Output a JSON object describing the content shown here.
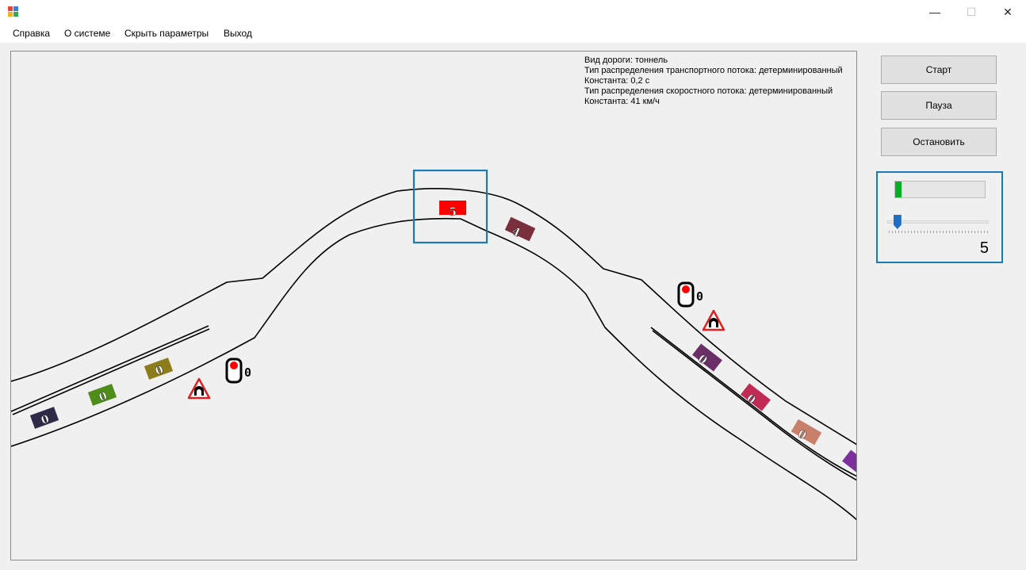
{
  "window": {
    "minimize_glyph": "—",
    "maximize_glyph": "☐",
    "close_glyph": "✕"
  },
  "menu": [
    "Справка",
    "О системе",
    "Скрыть параметры",
    "Выход"
  ],
  "info": {
    "lines": [
      "Вид дороги: тоннель",
      "Тип распределения транспортного потока: детерминированный",
      "Константа: 0,2 с",
      "Тип распределения скоростного потока: детерминированный",
      "Константа: 41 км/ч"
    ]
  },
  "buttons": {
    "start": "Старт",
    "pause": "Пауза",
    "stop": "Остановить"
  },
  "speed_panel": {
    "progress_fraction": 0.07,
    "slider_fraction": 0.1,
    "value": "5",
    "colors": {
      "border": "#1a7ab5",
      "progress": "#06b025",
      "thumb": "#1e6fc4"
    }
  },
  "scene": {
    "cars": [
      {
        "label": "0",
        "color": "#2e2a48"
      },
      {
        "label": "0",
        "color": "#4f8d1a"
      },
      {
        "label": "0",
        "color": "#8d7c1c"
      },
      {
        "label": "5",
        "color": "#ff0000"
      },
      {
        "label": "4",
        "color": "#7a2f3c"
      },
      {
        "label": "0",
        "color": "#6b2f68"
      },
      {
        "label": "0",
        "color": "#c02a53"
      },
      {
        "label": "0",
        "color": "#c8806a"
      },
      {
        "label": "",
        "color": "#7d2f9b"
      }
    ],
    "traffic_lights": [
      {
        "label": "0"
      },
      {
        "label": "0"
      }
    ],
    "signs": [
      "tunnel-warning-icon",
      "tunnel-warning-icon"
    ]
  }
}
